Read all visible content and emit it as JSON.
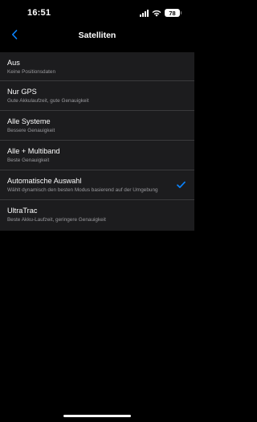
{
  "status_bar": {
    "time": "16:51",
    "battery": "78"
  },
  "header": {
    "title": "Satelliten",
    "back_icon": "chevron-left-icon"
  },
  "accent_color": "#0a84ff",
  "options": [
    {
      "title": "Aus",
      "subtitle": "Keine Positionsdaten",
      "selected": false
    },
    {
      "title": "Nur GPS",
      "subtitle": "Gute Akkulaufzeit, gute Genauigkeit",
      "selected": false
    },
    {
      "title": "Alle Systeme",
      "subtitle": "Bessere Genauigkeit",
      "selected": false
    },
    {
      "title": "Alle + Multiband",
      "subtitle": "Beste Genauigkeit",
      "selected": false
    },
    {
      "title": "Automatische Auswahl",
      "subtitle": "Wählt dynamisch den besten Modus basierend auf der Umgebung",
      "selected": true
    },
    {
      "title": "UltraTrac",
      "subtitle": "Beste Akku-Laufzeit, geringere Genauigkeit",
      "selected": false
    }
  ]
}
